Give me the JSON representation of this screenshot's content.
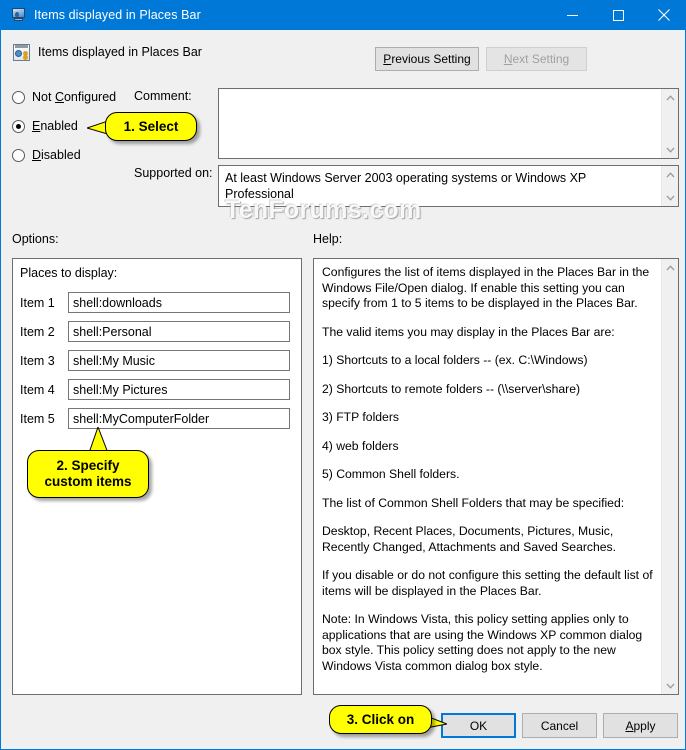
{
  "window": {
    "title": "Items displayed in Places Bar",
    "icon": "monitor-user-icon",
    "controls": {
      "minimize": "minimize-icon",
      "maximize": "maximize-icon",
      "close": "close-icon"
    }
  },
  "header": {
    "icon": "policy-setting-icon",
    "title": "Items displayed in Places Bar",
    "previous_setting": "Previous Setting",
    "previous_setting_accel": "P",
    "next_setting": "Next Setting",
    "next_setting_accel": "N",
    "next_setting_disabled": true
  },
  "state": {
    "options": [
      {
        "label": "Not Configured",
        "accel": "C",
        "selected": false
      },
      {
        "label": "Enabled",
        "accel": "E",
        "selected": true
      },
      {
        "label": "Disabled",
        "accel": "D",
        "selected": false
      }
    ]
  },
  "comment": {
    "label": "Comment:",
    "value": "",
    "placeholder": ""
  },
  "supported_on": {
    "label": "Supported on:",
    "value": "At least Windows Server 2003 operating systems or Windows XP Professional"
  },
  "options_panel": {
    "label": "Options:",
    "title": "Places to display:",
    "items": [
      {
        "label": "Item 1",
        "value": "shell:downloads"
      },
      {
        "label": "Item 2",
        "value": "shell:Personal"
      },
      {
        "label": "Item 3",
        "value": "shell:My Music"
      },
      {
        "label": "Item 4",
        "value": "shell:My Pictures"
      },
      {
        "label": "Item 5",
        "value": "shell:MyComputerFolder"
      }
    ]
  },
  "help_panel": {
    "label": "Help:",
    "paragraphs": [
      "Configures the list of items displayed in the Places Bar in the Windows File/Open dialog. If enable this setting you can specify from 1 to 5 items to be displayed in the Places Bar.",
      "The valid items you may display in the Places Bar are:",
      "1) Shortcuts to a local folders -- (ex. C:\\Windows)",
      "2) Shortcuts to remote folders -- (\\\\server\\share)",
      "3) FTP folders",
      "4) web folders",
      "5) Common Shell folders.",
      "The list of Common Shell Folders that may be specified:",
      "Desktop, Recent Places, Documents, Pictures, Music, Recently Changed, Attachments and Saved Searches.",
      "If you disable or do not configure this setting the default list of items will be displayed in the Places Bar.",
      "Note: In Windows Vista, this policy  setting applies only to applications that are using the Windows XP common dialog box style. This policy setting does not apply to the new Windows Vista common dialog box style."
    ]
  },
  "footer": {
    "ok": "OK",
    "cancel": "Cancel",
    "apply": "Apply",
    "apply_accel": "A"
  },
  "callouts": {
    "select": "1. Select",
    "specify_line1": "2. Specify",
    "specify_line2": "custom items",
    "click": "3. Click on"
  },
  "watermark": "TenForums.com",
  "colors": {
    "titlebar": "#0078d7",
    "window_bg": "#f0f0f0",
    "callout": "#ffff00",
    "focus_border": "#0078d7"
  }
}
